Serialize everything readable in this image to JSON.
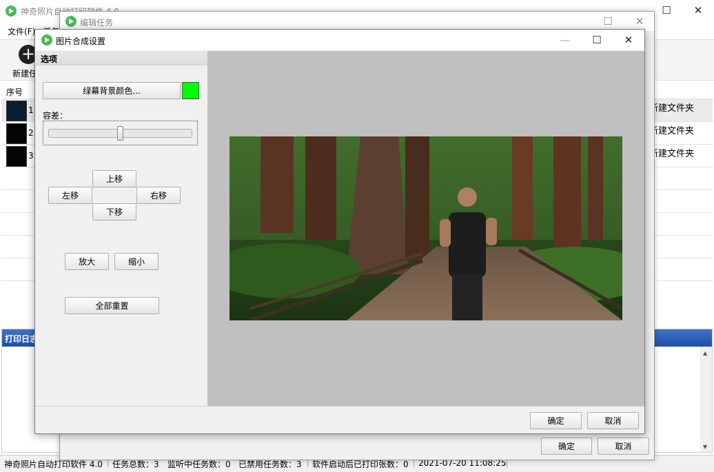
{
  "main": {
    "title": "神奇照片自动打印软件 4.0",
    "menu": [
      "文件(F)",
      "任务"
    ],
    "new_task_label": "新建任务",
    "table_header": "序号",
    "rows": [
      {
        "index": "1",
        "folder": "新建文件夹"
      },
      {
        "index": "2",
        "folder": "新建文件夹"
      },
      {
        "index": "3",
        "folder": "新建文件夹"
      }
    ],
    "log_header": "打印日志",
    "status": {
      "app": "神奇照片自动打印软件 4.0",
      "total": "任务总数：3",
      "monitoring": "监听中任务数：0",
      "disabled": "已禁用任务数：3",
      "printed": "软件启动后已打印张数：0",
      "datetime": "2021-07-20 11:08:25"
    }
  },
  "edit_task": {
    "title": "编辑任务",
    "ok": "确定",
    "cancel": "取消"
  },
  "dialog": {
    "title": "图片合成设置",
    "options_header": "选项",
    "greenscreen_button": "绿幕背景颜色...",
    "greenscreen_color": "#00ff00",
    "tolerance_label": "容差：",
    "tolerance_value": 0.5,
    "up": "上移",
    "left": "左移",
    "right": "右移",
    "down": "下移",
    "zoom_in": "放大",
    "zoom_out": "缩小",
    "reset_all": "全部重置",
    "ok": "确定",
    "cancel": "取消"
  },
  "icons": {
    "app": "app-play-icon",
    "add": "plus-circle-icon",
    "minimize": "minimize-icon",
    "maximize": "maximize-icon",
    "close": "close-icon"
  }
}
